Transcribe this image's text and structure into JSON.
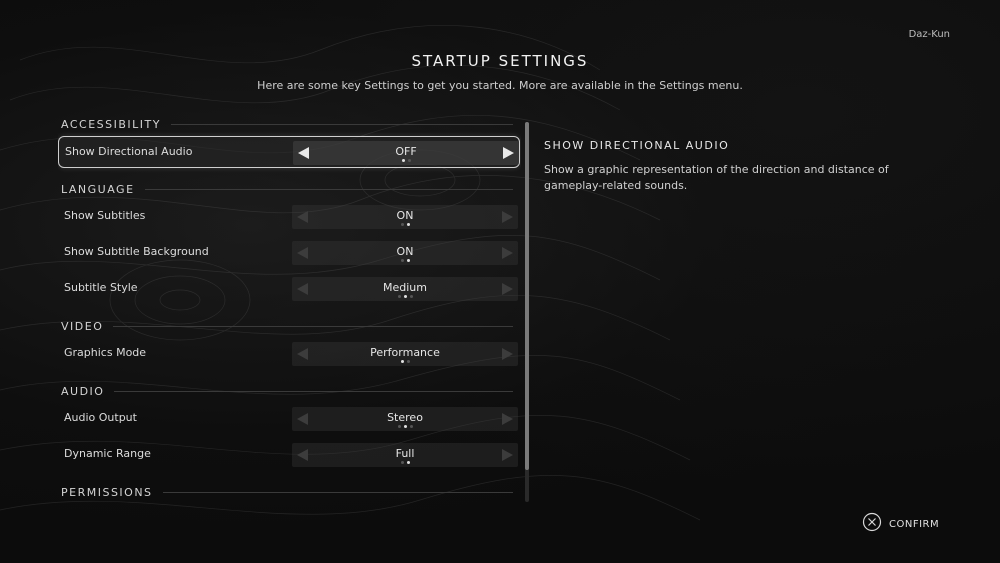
{
  "header": {
    "username": "Daz-Kun",
    "title": "STARTUP SETTINGS",
    "subtitle": "Here are some key Settings to get you started. More are available in the Settings menu."
  },
  "sections": [
    {
      "label": "ACCESSIBILITY",
      "rows": [
        {
          "label": "Show Directional Audio",
          "value": "OFF",
          "options": 2,
          "active": 0,
          "selected": true
        }
      ]
    },
    {
      "label": "LANGUAGE",
      "rows": [
        {
          "label": "Show Subtitles",
          "value": "ON",
          "options": 2,
          "active": 1,
          "selected": false
        },
        {
          "label": "Show Subtitle Background",
          "value": "ON",
          "options": 2,
          "active": 1,
          "selected": false
        },
        {
          "label": "Subtitle Style",
          "value": "Medium",
          "options": 3,
          "active": 1,
          "selected": false
        }
      ]
    },
    {
      "label": "VIDEO",
      "rows": [
        {
          "label": "Graphics Mode",
          "value": "Performance",
          "options": 2,
          "active": 0,
          "selected": false
        }
      ]
    },
    {
      "label": "AUDIO",
      "rows": [
        {
          "label": "Audio Output",
          "value": "Stereo",
          "options": 3,
          "active": 1,
          "selected": false
        },
        {
          "label": "Dynamic Range",
          "value": "Full",
          "options": 2,
          "active": 1,
          "selected": false
        }
      ]
    },
    {
      "label": "PERMISSIONS",
      "rows": []
    }
  ],
  "detail": {
    "title": "SHOW DIRECTIONAL AUDIO",
    "text": "Show a graphic representation of the direction and distance of gameplay-related sounds."
  },
  "footer": {
    "confirm_label": "CONFIRM",
    "confirm_icon": "cross-button-icon"
  }
}
